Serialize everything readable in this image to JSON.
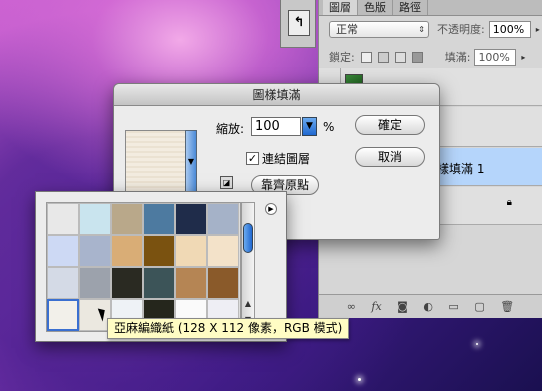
{
  "layers_panel": {
    "tabs": [
      "圖層",
      "色版",
      "路徑"
    ],
    "blend_mode": "正常",
    "opacity_label": "不透明度:",
    "opacity_value": "100%",
    "lock_label": "鎖定:",
    "fill_label": "填滿:",
    "fill_value": "100%",
    "selected_layer_name": "樣填滿 1"
  },
  "dialog": {
    "title": "圖樣填滿",
    "scale_label": "縮放:",
    "scale_value": "100",
    "percent": "%",
    "link_checkbox_label": "連結圖層",
    "link_checked": true,
    "snap_button": "靠齊原點",
    "ok_button": "確定",
    "cancel_button": "取消"
  },
  "picker": {
    "swatch_colors": [
      "#e8e8e8",
      "#c9e4ee",
      "#b9a88a",
      "#4d7aa0",
      "#1f2c4a",
      "#a5b2c8",
      "#cdd9f4",
      "#a8b4cc",
      "#d9ad76",
      "#7a5210",
      "#f0d9b5",
      "#f3e2c9",
      "#d4dae6",
      "#9ca2ac",
      "#2a2a22",
      "#3c5458",
      "#b58554",
      "#8a5a2a",
      "#f2f0ea",
      "#ebe8e0",
      "#eef2f6",
      "#25261c",
      "#fafafa",
      "#eeeef4"
    ],
    "tooltip": "亞麻編織紙 (128 X 112 像素，RGB 模式)"
  }
}
